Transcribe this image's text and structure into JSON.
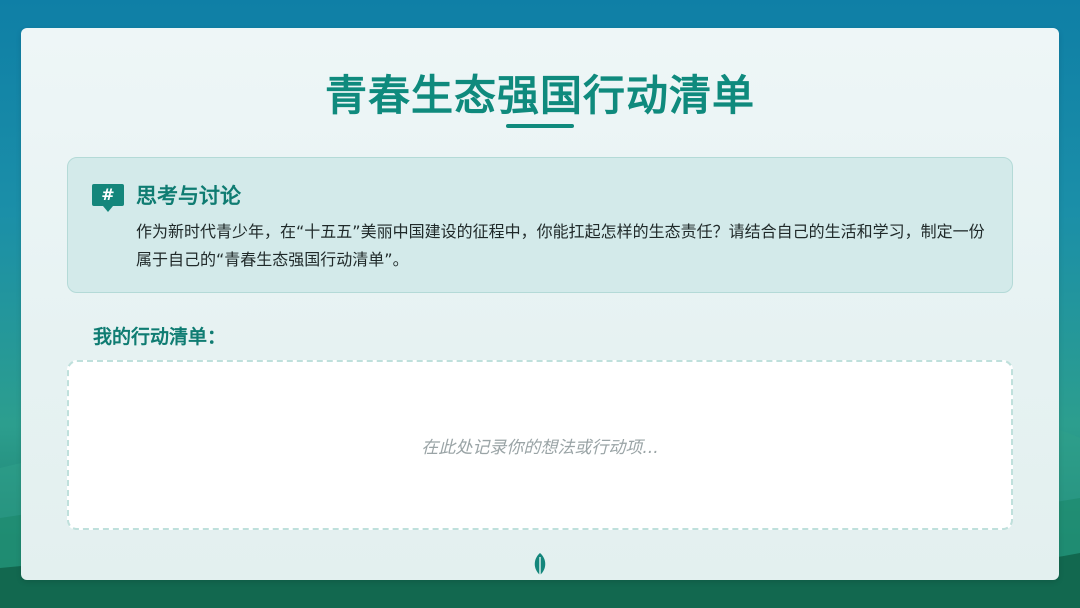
{
  "slide": {
    "title": "青春生态强国行动清单"
  },
  "discussion": {
    "icon": "hash-icon",
    "heading": "思考与讨论",
    "text": "作为新时代青少年，在“十五五”美丽中国建设的征程中，你能扛起怎样的生态责任？请结合自己的生活和学习，制定一份属于自己的“青春生态强国行动清单”。"
  },
  "action_list": {
    "label": "我的行动清单：",
    "placeholder": "在此处记录你的想法或行动项..."
  },
  "footer": {
    "icon": "leaf-icon"
  },
  "colors": {
    "accent": "#0f8a7d",
    "panel": "#d3eaea",
    "background_top": "#0f7fa6",
    "background_bottom": "#14705c"
  }
}
